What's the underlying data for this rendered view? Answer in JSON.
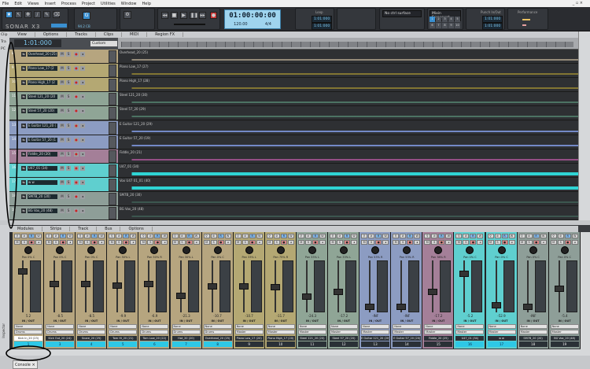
{
  "app": {
    "logo": "SONAR X3"
  },
  "menu": [
    "File",
    "Edit",
    "Views",
    "Insert",
    "Process",
    "Project",
    "Utilities",
    "Window",
    "Help"
  ],
  "control_bar": {
    "time": "01:00:00:00",
    "tempo": "120.00",
    "meter": "4/4",
    "cpu": "94.2 CB",
    "loop_label": "Loop",
    "loop_start": "1:01:000",
    "loop_end": "1:01:000",
    "punch_label": "Punch In/Out",
    "punch_start": "1:01:000",
    "punch_end": "1:01:000",
    "surface": "No ctrl surface",
    "screenset": "Mixin Screenset",
    "screensets": [
      "1",
      "2",
      "3",
      "4",
      "5",
      "6",
      "7",
      "8",
      "9",
      "10"
    ],
    "performance_label": "Performance"
  },
  "track_view": {
    "menus": [
      "View",
      "Options",
      "Tracks",
      "Clips",
      "MIDI",
      "Region FX"
    ],
    "left_tabs": [
      "Clip",
      "Tra",
      "PC"
    ],
    "now_time": "1:01:000",
    "snap": "Custom",
    "tracks": [
      {
        "num": "8",
        "name": "Overhead_20 (25)",
        "clip": "Overhead_20 (25)",
        "color": "#b6a57f",
        "wave": "#d8c8a8"
      },
      {
        "num": "9",
        "name": "Piano Low_17 (2",
        "clip": "Piano Low_17 (27)",
        "color": "#b4a873",
        "wave": "#8a7d33"
      },
      {
        "num": "10",
        "name": "Piano High_17 (2",
        "clip": "Piano High_17 (28)",
        "color": "#b4a873",
        "wave": "#8a7d33"
      },
      {
        "num": "11",
        "name": "Steel 121_20 (20",
        "clip": "Steel 121_20 (30)",
        "color": "#8fa596",
        "wave": "#4f7a68"
      },
      {
        "num": "12",
        "name": "Steel 57_20 (20)",
        "clip": "Steel 57_20 (29)",
        "color": "#8fa596",
        "wave": "#4f7a68"
      },
      {
        "num": "13",
        "name": "E Guitar 121_20 (",
        "clip": "E Guitar 121_20 (29)",
        "color": "#8c9cc2",
        "wave": "#7b93d6"
      },
      {
        "num": "14",
        "name": "E Guitar 57_20 (1",
        "clip": "E Guitar 57_20 (19)",
        "color": "#8c9cc2",
        "wave": "#7b93d6"
      },
      {
        "num": "15",
        "name": "Fiddle_20 (20)",
        "clip": "Fiddle_20 (21)",
        "color": "#a47f98",
        "wave": "#a0528e"
      },
      {
        "num": "16",
        "name": "U47_01 (34)",
        "clip": "U47_01 (34)",
        "color": "#5fcfcf",
        "wave": "#2fe6e6"
      },
      {
        "num": "17",
        "name": "w w",
        "clip": "Vox U47 01_01 (40)",
        "color": "#5fcfcf",
        "wave": "#2fe6e6"
      },
      {
        "num": "18",
        "name": "SM7B_20 (20)",
        "clip": "SM7B_20 (30)",
        "color": "#8e9e98",
        "wave": "#3e5a52"
      },
      {
        "num": "19",
        "name": "BG Vox_20 (48)",
        "clip": "BG Vox_20 (48)",
        "color": "#8e9e98",
        "wave": "#3e5a52"
      }
    ],
    "buttons": {
      "mute": "M",
      "solo": "S"
    }
  },
  "console": {
    "menus": [
      "Modules",
      "Strips",
      "Track",
      "Bus",
      "Options"
    ],
    "io_label": "IN / OUT",
    "tab": "Console",
    "inspector": "Inspector",
    "strips": [
      {
        "name": "Kick In_20 (23)",
        "num": "1",
        "vol": "5.2",
        "pan": "Pan 0% C",
        "in": "None",
        "out": "Drums",
        "color": "#b6a57f",
        "level": 0.82
      },
      {
        "name": "Kick Out_20 (24)",
        "num": "3",
        "vol": "-8.5",
        "pan": "Pan 0% C",
        "in": "None",
        "out": "Drums",
        "color": "#b6a57f",
        "level": 0.55
      },
      {
        "name": "Snare_20 (25)",
        "num": "4",
        "vol": "-8.5",
        "pan": "Pan 0% C",
        "in": "None",
        "out": "Drums",
        "color": "#b6a57f",
        "level": 0.55
      },
      {
        "name": "Tom Hi_20 (21)",
        "num": "5",
        "vol": "-9.9",
        "pan": "Pan 50% L",
        "in": "None",
        "out": "Drums",
        "color": "#b6a57f",
        "level": 0.52
      },
      {
        "name": "Tom Low_20 (22)",
        "num": "6",
        "vol": "-6.9",
        "pan": "Pan 50% R",
        "in": "None",
        "out": "Drums",
        "color": "#b6a57f",
        "level": 0.55
      },
      {
        "name": "Hat_20 (20)",
        "num": "7",
        "vol": "-21.3",
        "pan": "Pan 30% L",
        "in": "None",
        "out": "Drums",
        "color": "#b6a57f",
        "level": 0.3
      },
      {
        "name": "Overhead_20 (25)",
        "num": "8",
        "vol": "-10.7",
        "pan": "Pan 0% C",
        "in": "None",
        "out": "Drums",
        "color": "#b6a57f",
        "level": 0.5
      },
      {
        "name": "Piano Low_17 (20)",
        "num": "9",
        "vol": "-10.7",
        "pan": "Pan 33% L",
        "in": "None",
        "out": "Master",
        "color": "#b4a873",
        "level": 0.5
      },
      {
        "name": "Piano High_17 (20)",
        "num": "10",
        "vol": "-11.7",
        "pan": "Pan 75% R",
        "in": "None",
        "out": "Master",
        "color": "#b4a873",
        "level": 0.48
      },
      {
        "name": "Steel 121_20 (20)",
        "num": "11",
        "vol": "-24.3",
        "pan": "Pan 33% L",
        "in": "None",
        "out": "Master",
        "color": "#8fa596",
        "level": 0.28
      },
      {
        "name": "Steel 57_20 (20)",
        "num": "12",
        "vol": "-17.2",
        "pan": "Pan 33% L",
        "in": "None",
        "out": "Master",
        "color": "#8fa596",
        "level": 0.38
      },
      {
        "name": "E Guitar 121_20 (20)",
        "num": "13",
        "vol": "-INF",
        "pan": "Pan 53% R",
        "in": "None",
        "out": "Master",
        "color": "#8c9cc2",
        "level": 0.05
      },
      {
        "name": "E Guitar 57_20 (20)",
        "num": "14",
        "vol": "-INF",
        "pan": "Pan 53% R",
        "in": "None",
        "out": "Master",
        "color": "#8c9cc2",
        "level": 0.05
      },
      {
        "name": "Fiddle_20 (25)",
        "num": "15",
        "vol": "-17.2",
        "pan": "Pan 38% R",
        "in": "None",
        "out": "Master",
        "color": "#a47f98",
        "level": 0.38
      },
      {
        "name": "U47_01 (34)",
        "num": "16",
        "vol": "-5.2",
        "pan": "Pan 0% C",
        "in": "None",
        "out": "Master",
        "color": "#5fcfcf",
        "level": 0.78
      },
      {
        "name": "w w",
        "num": "17",
        "vol": "-52.9",
        "pan": "Pan 0% C",
        "in": "None",
        "out": "Master",
        "color": "#5fcfcf",
        "level": 0.08
      },
      {
        "name": "SM7B_20 (20)",
        "num": "18",
        "vol": "-INF",
        "pan": "Pan 0% C",
        "in": "None",
        "out": "Master",
        "color": "#8e9e98",
        "level": 0.05
      },
      {
        "name": "BG Vox_20 (48)",
        "num": "19",
        "vol": "-5.4",
        "pan": "Pan 0% C",
        "in": "None",
        "out": "Master",
        "color": "#8e9e98",
        "level": 0.45
      }
    ]
  }
}
